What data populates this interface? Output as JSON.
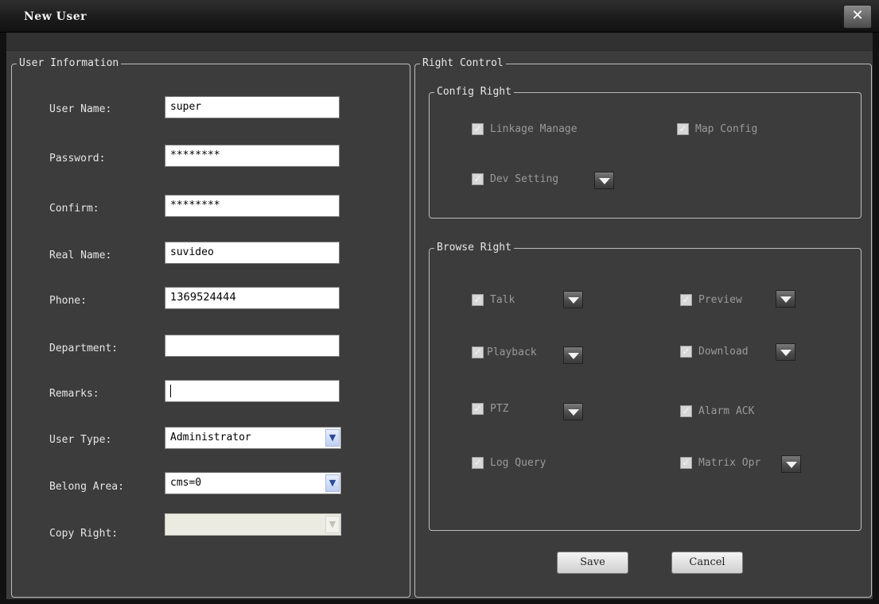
{
  "window": {
    "title": "New User",
    "close_glyph": "✕"
  },
  "user_info": {
    "legend": "User Information",
    "fields": {
      "user_name": {
        "label": "User Name:",
        "value": "super"
      },
      "password": {
        "label": "Password:",
        "value": "********"
      },
      "confirm": {
        "label": "Confirm:",
        "value": "********"
      },
      "real_name": {
        "label": "Real Name:",
        "value": "suvideo"
      },
      "phone": {
        "label": "Phone:",
        "value": "1369524444"
      },
      "department": {
        "label": "Department:",
        "value": ""
      },
      "remarks": {
        "label": "Remarks:",
        "value": ""
      },
      "user_type": {
        "label": "User Type:",
        "value": "Administrator"
      },
      "belong_area": {
        "label": "Belong Area:",
        "value": "cms=0"
      },
      "copy_right": {
        "label": "Copy Right:",
        "value": ""
      }
    }
  },
  "right_control": {
    "legend": "Right Control",
    "config_right": {
      "legend": "Config Right",
      "linkage_manage": {
        "label": "Linkage Manage",
        "checked": true
      },
      "map_config": {
        "label": "Map Config",
        "checked": true
      },
      "dev_setting": {
        "label": "Dev Setting",
        "checked": true
      }
    },
    "browse_right": {
      "legend": "Browse Right",
      "talk": {
        "label": "Talk",
        "checked": true
      },
      "preview": {
        "label": "Preview",
        "checked": true
      },
      "playback": {
        "label": "Playback",
        "checked": true
      },
      "download": {
        "label": "Download",
        "checked": true
      },
      "ptz": {
        "label": "PTZ",
        "checked": true
      },
      "alarm_ack": {
        "label": "Alarm ACK",
        "checked": true
      },
      "log_query": {
        "label": "Log Query",
        "checked": true
      },
      "matrix_opr": {
        "label": "Matrix Opr",
        "checked": true
      }
    }
  },
  "buttons": {
    "save": "Save",
    "cancel": "Cancel"
  },
  "glyphs": {
    "check": "✓",
    "dropdown": "▼"
  },
  "colors": {
    "background": "#3c3c3c",
    "border": "#bdbdbd",
    "disabled_text": "#9a9a9a"
  }
}
